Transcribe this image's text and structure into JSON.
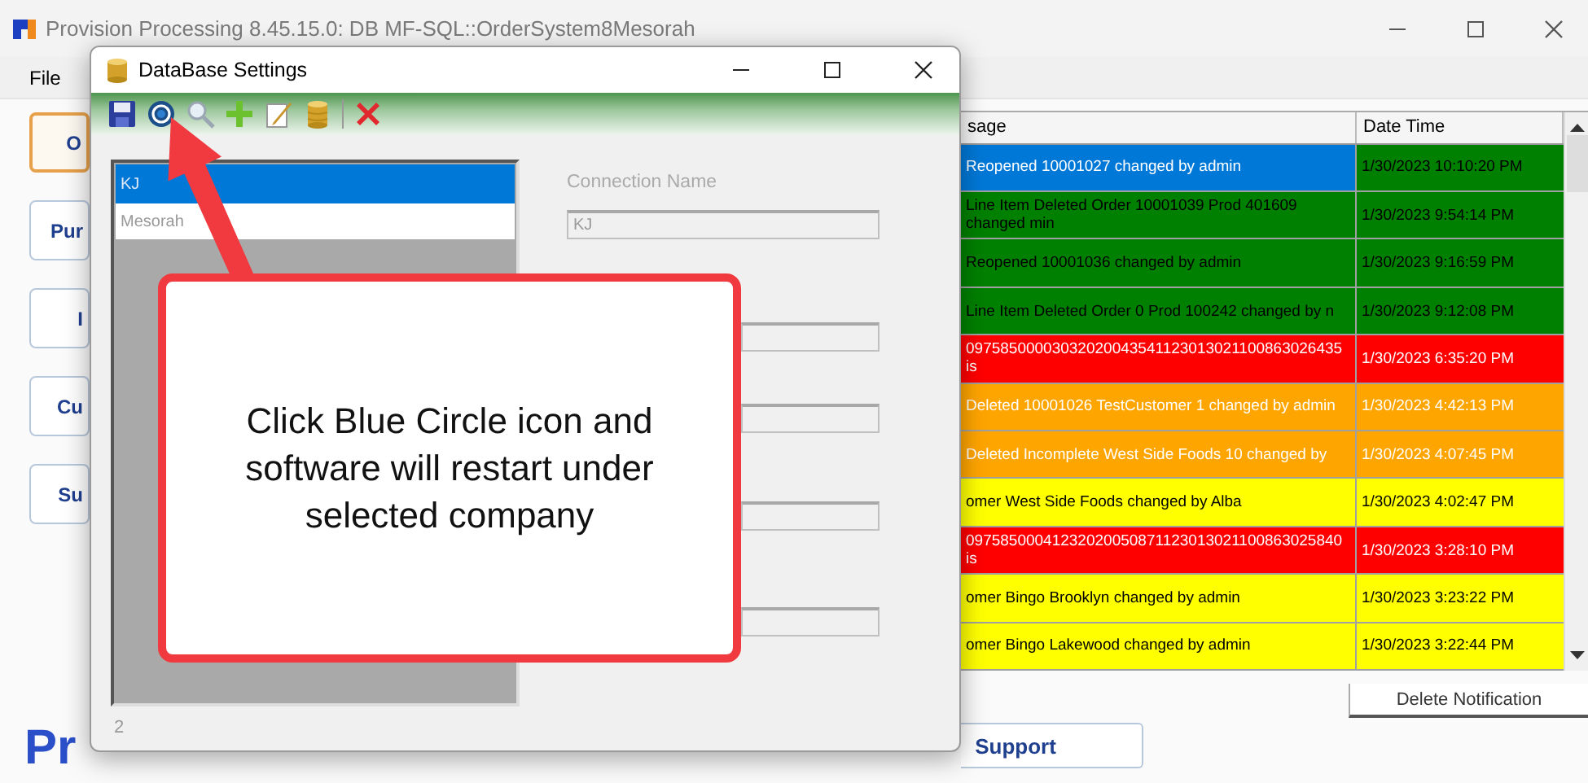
{
  "window": {
    "title": "Provision Processing 8.45.15.0: DB MF-SQL::OrderSystem8Mesorah"
  },
  "menu": [
    {
      "label": "File"
    }
  ],
  "nav_buttons": [
    {
      "label": "O",
      "selected": true
    },
    {
      "label": "Pur",
      "selected": false
    },
    {
      "label": "I",
      "selected": false
    },
    {
      "label": "Cu",
      "selected": false
    },
    {
      "label": "Su",
      "selected": false
    }
  ],
  "notifications": {
    "columns": [
      "sage",
      "Date Time"
    ],
    "rows": [
      {
        "message": "Reopened 10001027 changed by admin",
        "datetime": "1/30/2023 10:10:20 PM",
        "color": "#008000",
        "selected": true
      },
      {
        "message": "Line Item Deleted Order 10001039 Prod 401609 changed min",
        "datetime": "1/30/2023 9:54:14 PM",
        "color": "#008000",
        "selected": false
      },
      {
        "message": "Reopened 10001036 changed by admin",
        "datetime": "1/30/2023 9:16:59 PM",
        "color": "#008000",
        "selected": false
      },
      {
        "message": "Line Item Deleted Order 0 Prod 100242 changed by n",
        "datetime": "1/30/2023 9:12:08 PM",
        "color": "#008000",
        "selected": false
      },
      {
        "message": "09758500003032020043541123013021100863026435 is",
        "datetime": "1/30/2023 6:35:20 PM",
        "color": "#ff0000",
        "selected": false
      },
      {
        "message": "Deleted 10001026 TestCustomer 1 changed by admin",
        "datetime": "1/30/2023 4:42:13 PM",
        "color": "#ffa500",
        "selected": false
      },
      {
        "message": "Deleted Incomplete West Side Foods 10 changed by",
        "datetime": "1/30/2023 4:07:45 PM",
        "color": "#ffa500",
        "selected": false
      },
      {
        "message": "omer West Side Foods changed by Alba",
        "datetime": "1/30/2023 4:02:47 PM",
        "color": "#ffff00",
        "selected": false
      },
      {
        "message": "09758500041232020050871123013021100863025840 is",
        "datetime": "1/30/2023 3:28:10 PM",
        "color": "#ff0000",
        "selected": false
      },
      {
        "message": "omer Bingo Brooklyn changed by admin",
        "datetime": "1/30/2023 3:23:22 PM",
        "color": "#ffff00",
        "selected": false
      },
      {
        "message": "omer Bingo Lakewood changed by admin",
        "datetime": "1/30/2023 3:22:44 PM",
        "color": "#ffff00",
        "selected": false
      }
    ]
  },
  "delete_button": "Delete Notification",
  "support_button": "Support",
  "logo_text": "Pr",
  "dialog": {
    "title": "DataBase Settings",
    "connections": [
      {
        "label": "KJ",
        "selected": true
      },
      {
        "label": "Mesorah",
        "selected": false
      }
    ],
    "count": "2",
    "fields": [
      {
        "label": "Connection Name",
        "value": "KJ",
        "disabled": true
      }
    ]
  },
  "callout": {
    "text": "Click Blue Circle icon and software will restart under selected company"
  }
}
